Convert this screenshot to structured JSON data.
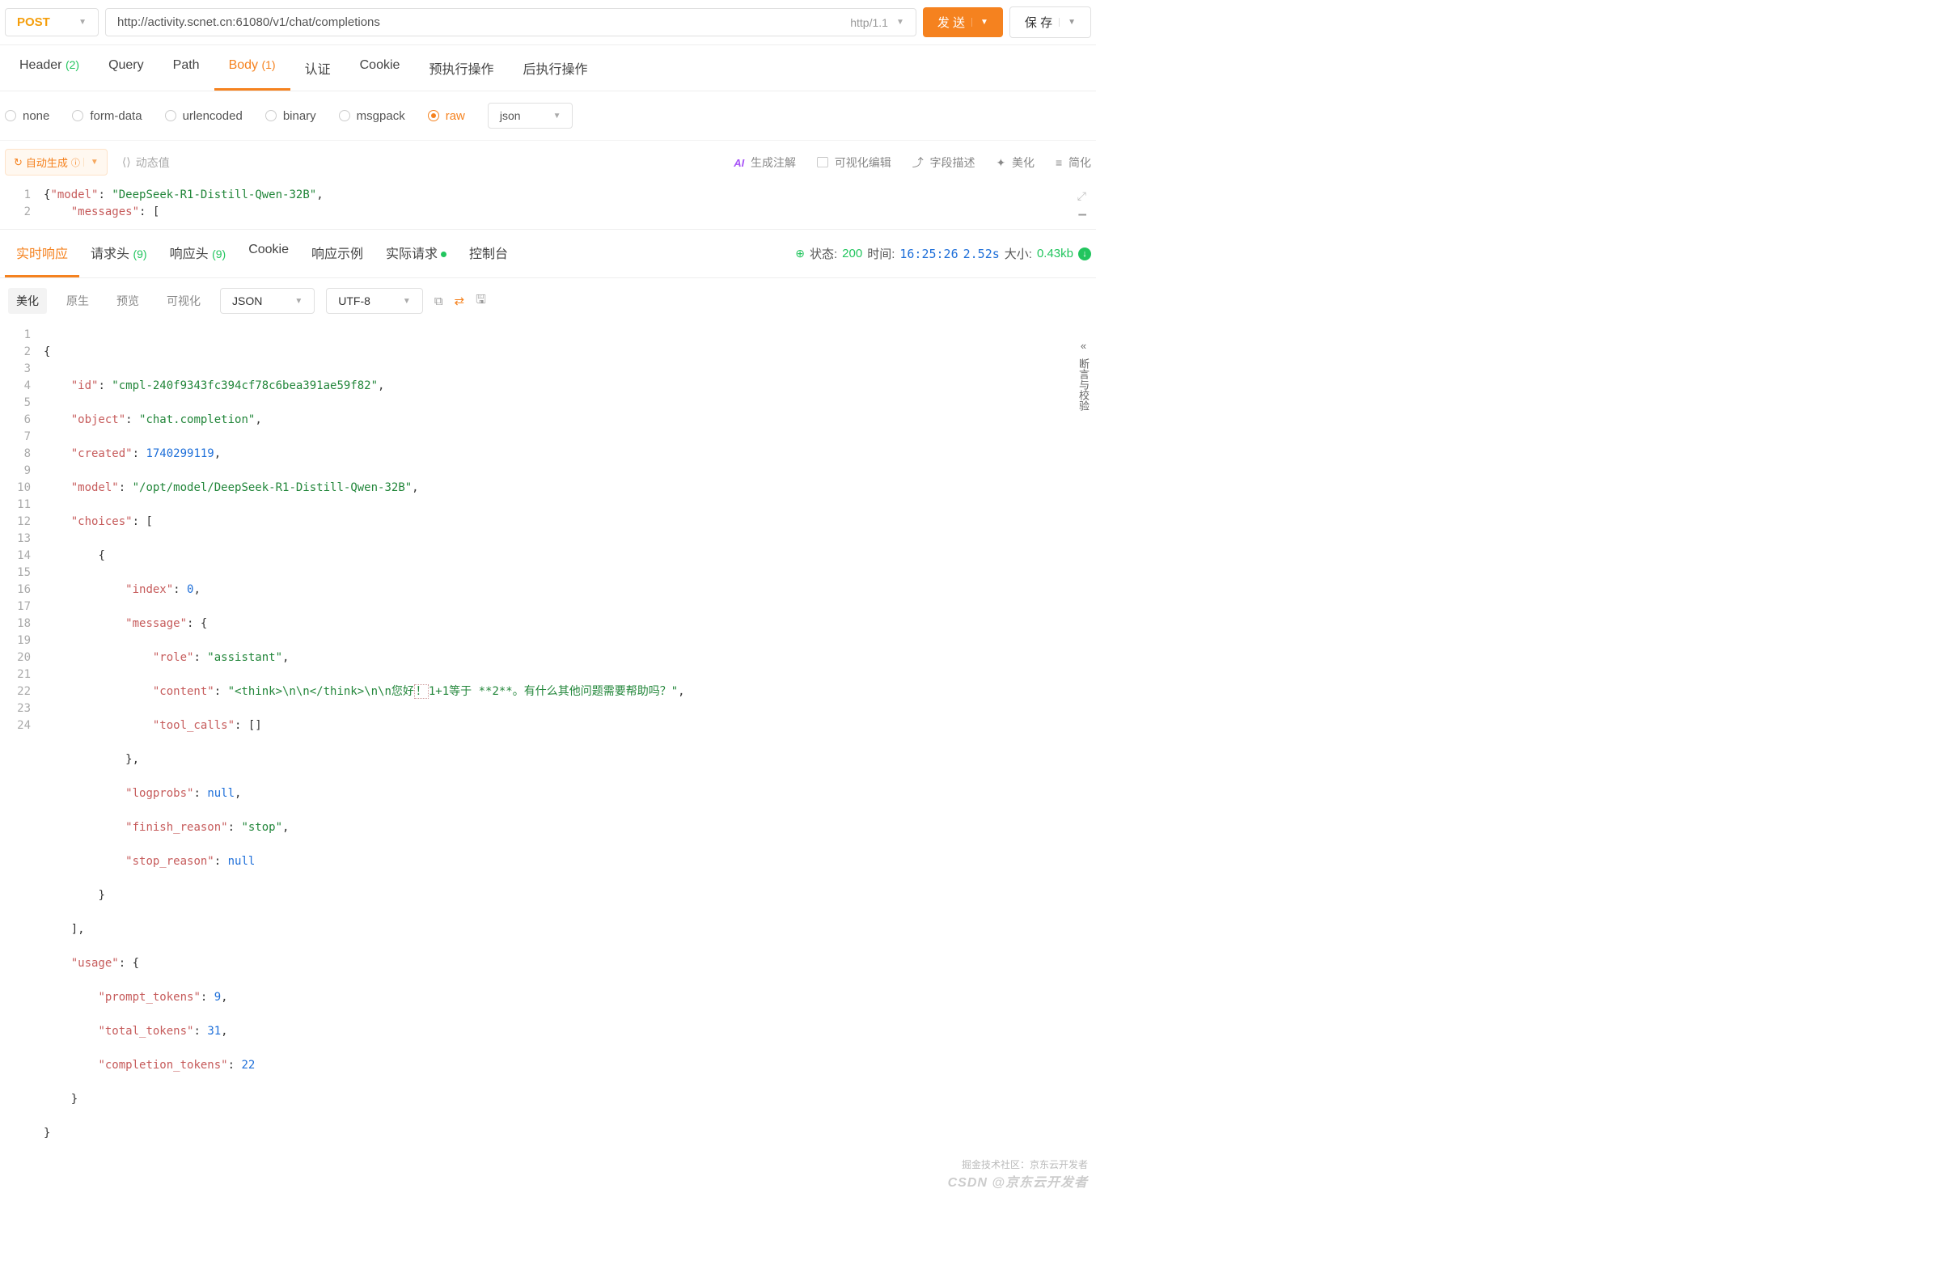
{
  "topbar": {
    "method": "POST",
    "url": "http://activity.scnet.cn:61080/v1/chat/completions",
    "http_version": "http/1.1",
    "send": "发 送",
    "save": "保 存"
  },
  "reqTabs": {
    "header": "Header",
    "header_cnt": "(2)",
    "query": "Query",
    "path": "Path",
    "body": "Body",
    "body_cnt": "(1)",
    "auth": "认证",
    "cookie": "Cookie",
    "pre": "预执行操作",
    "post": "后执行操作"
  },
  "bodyTypes": {
    "none": "none",
    "form": "form-data",
    "url": "urlencoded",
    "binary": "binary",
    "msgpack": "msgpack",
    "raw": "raw",
    "format": "json"
  },
  "reqToolbar": {
    "auto": "自动生成",
    "dynamic": "动态值",
    "ai": "AI",
    "ai_annotate": "生成注解",
    "visual_edit": "可视化编辑",
    "field_desc": "字段描述",
    "beautify": "美化",
    "simplify": "简化"
  },
  "reqBody": {
    "l1_a": "{",
    "l1_k": "\"model\"",
    "l1_c": ": ",
    "l1_v": "\"DeepSeek-R1-Distill-Qwen-32B\"",
    "l1_e": ",",
    "l2_i": "    ",
    "l2_k": "\"messages\"",
    "l2_c": ": [",
    "ln1": "1",
    "ln2": "2"
  },
  "respTabs": {
    "realtime": "实时响应",
    "req_headers": "请求头",
    "req_headers_cnt": "(9)",
    "resp_headers": "响应头",
    "resp_headers_cnt": "(9)",
    "cookie": "Cookie",
    "example": "响应示例",
    "actual": "实际请求",
    "console": "控制台"
  },
  "status": {
    "state_label": "状态:",
    "code": "200",
    "time_label": "时间:",
    "time": "16:25:26",
    "duration": "2.52s",
    "size_label": "大小:",
    "size": "0.43kb"
  },
  "viewControls": {
    "beautify": "美化",
    "raw": "原生",
    "preview": "预览",
    "visual": "可视化",
    "format": "JSON",
    "encoding": "UTF-8"
  },
  "sidePanel": {
    "label": "断言与校验"
  },
  "resp": {
    "ln": [
      "1",
      "2",
      "3",
      "4",
      "5",
      "6",
      "7",
      "8",
      "9",
      "10",
      "11",
      "12",
      "13",
      "14",
      "15",
      "16",
      "17",
      "18",
      "19",
      "20",
      "21",
      "22",
      "23",
      "24"
    ],
    "id_k": "\"id\"",
    "id_v": "\"cmpl-240f9343fc394cf78c6bea391ae59f82\"",
    "obj_k": "\"object\"",
    "obj_v": "\"chat.completion\"",
    "cr_k": "\"created\"",
    "cr_v": "1740299119",
    "mdl_k": "\"model\"",
    "mdl_v": "\"/opt/model/DeepSeek-R1-Distill-Qwen-32B\"",
    "ch_k": "\"choices\"",
    "idx_k": "\"index\"",
    "idx_v": "0",
    "msg_k": "\"message\"",
    "role_k": "\"role\"",
    "role_v": "\"assistant\"",
    "cnt_k": "\"content\"",
    "cnt_v1": "\"<think>\\n\\n</think>\\n\\n您好",
    "cnt_hl": "！",
    "cnt_v2": "1+1等于 **2**。有什么其他问题需要帮助吗？\"",
    "tc_k": "\"tool_calls\"",
    "lp_k": "\"logprobs\"",
    "null_v": "null",
    "fr_k": "\"finish_reason\"",
    "fr_v": "\"stop\"",
    "sr_k": "\"stop_reason\"",
    "usg_k": "\"usage\"",
    "pt_k": "\"prompt_tokens\"",
    "pt_v": "9",
    "tt_k": "\"total_tokens\"",
    "tt_v": "31",
    "ct_k": "\"completion_tokens\"",
    "ct_v": "22"
  },
  "watermark": {
    "csdn": "CSDN @京东云开发者",
    "juejin": "掘金技术社区：京东云开发者"
  }
}
